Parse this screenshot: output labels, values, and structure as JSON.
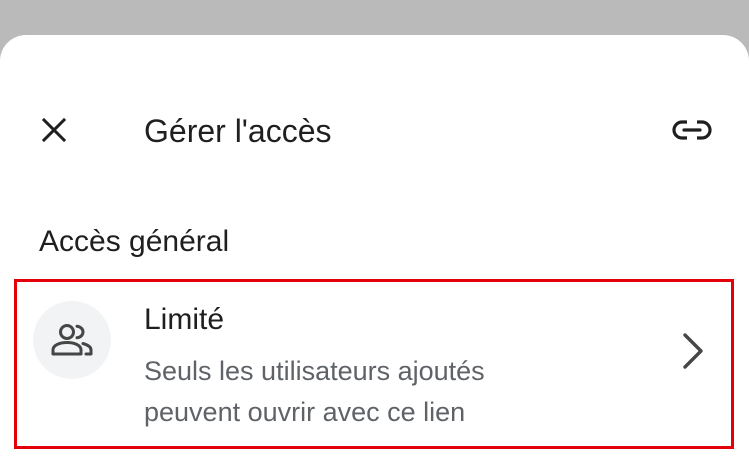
{
  "header": {
    "title": "Gérer l'accès",
    "close_icon": "close-icon",
    "link_icon": "link-icon"
  },
  "general_access": {
    "heading": "Accès général",
    "option": {
      "title": "Limité",
      "description_line1": "Seuls les utilisateurs ajoutés",
      "description_line2": "peuvent ouvrir avec ce lien",
      "icon": "people-icon",
      "chevron_icon": "chevron-right-icon"
    }
  },
  "colors": {
    "backdrop": "#b9bab9",
    "sheet": "#ffffff",
    "highlight_border": "#e3000b",
    "primary_text": "#1f1f1f",
    "secondary_text": "#5f6368",
    "icon_bg": "#f1f3f4"
  }
}
